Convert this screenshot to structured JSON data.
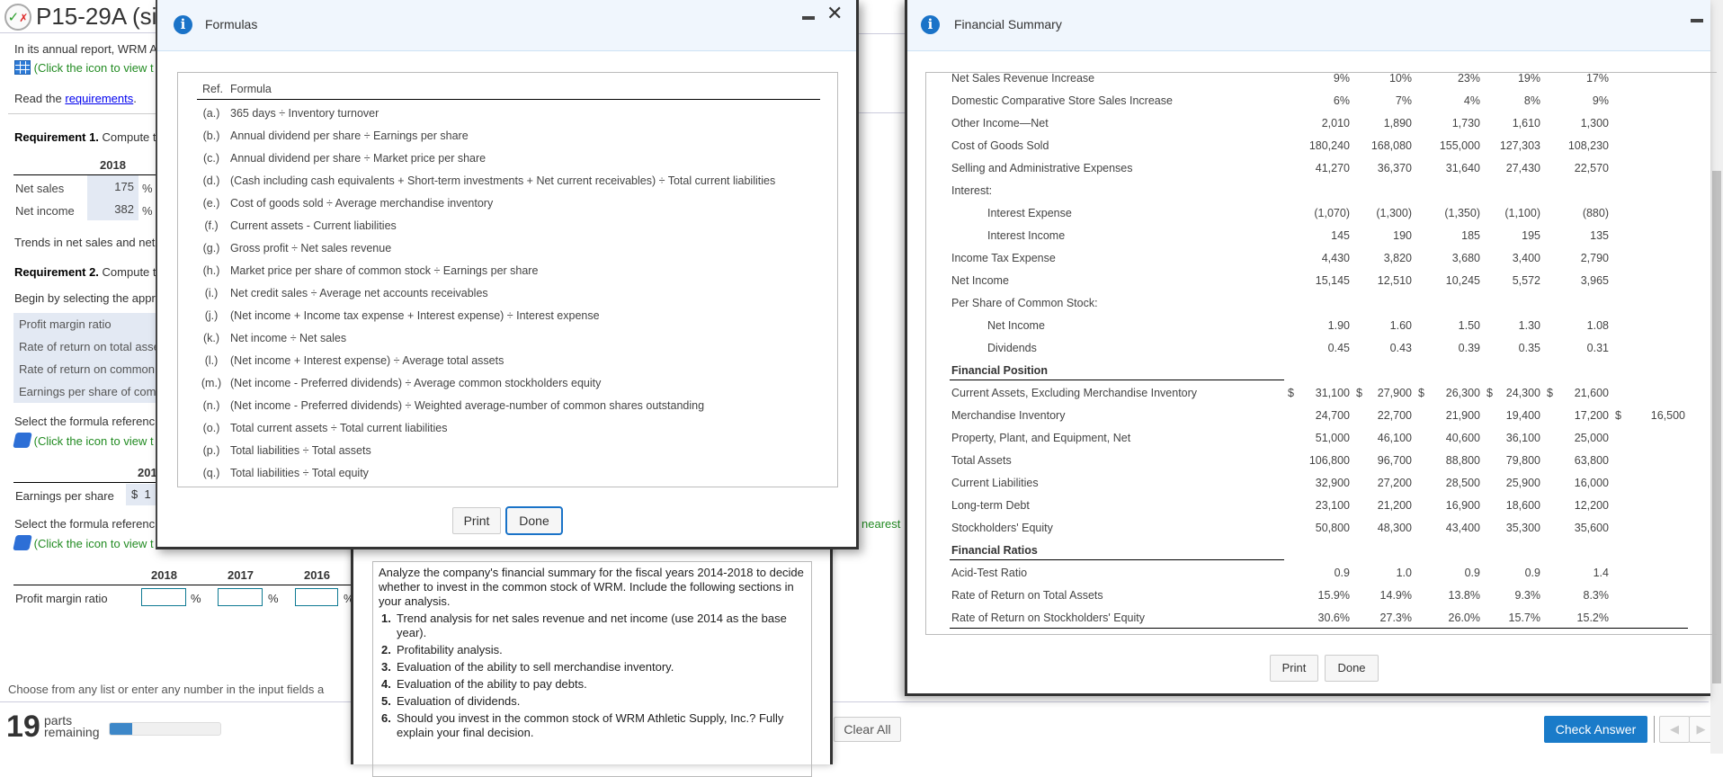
{
  "page": {
    "title": "P15-29A (sim",
    "intro": "In its annual report, WRM A",
    "click_icon_view": "(Click the icon to view t",
    "read_the": "Read the ",
    "requirements_link": "requirements",
    "read_period": ".",
    "req1_bold": "Requirement 1.",
    "req1_text": " Compute t",
    "req1_year": "2018",
    "req1_rows": [
      {
        "label": "Net sales",
        "value": "175",
        "unit": "%"
      },
      {
        "label": "Net income",
        "value": "382",
        "unit": "%"
      }
    ],
    "trends": "Trends in net sales and net",
    "req2_bold": "Requirement 2.",
    "req2_text": " Compute t",
    "begin": "Begin by selecting the appr",
    "ratio_list": [
      "Profit margin ratio",
      "Rate of return on total asse",
      "Rate of return on common",
      "Earnings per share of com"
    ],
    "select_formula_1": "Select the formula referenc",
    "click_icon_1": "(Click the icon to view t",
    "eps_year": "201",
    "eps_label": "Earnings per share",
    "eps_value": "$  1",
    "select_formula_2": "Select the formula referenc",
    "click_icon_2": "(Click the icon to view t",
    "pm_years": [
      "2018",
      "2017",
      "2016"
    ],
    "pm_label": "Profit margin ratio",
    "pm_unit": "%",
    "nearest": "nearest",
    "footer_hint": "Choose from any list or enter any number in the input fields a",
    "parts_count": "19",
    "parts_word1": "parts",
    "parts_word2": "remaining",
    "progress_fraction": 0.2,
    "clear_all": "Clear All",
    "check_answer": "Check Answer"
  },
  "formulas": {
    "title": "Formulas",
    "header_ref": "Ref.",
    "header_formula": "Formula",
    "rows": [
      {
        "ref": "(a.)",
        "formula": "365 days ÷ Inventory turnover"
      },
      {
        "ref": "(b.)",
        "formula": "Annual dividend per share ÷ Earnings per share"
      },
      {
        "ref": "(c.)",
        "formula": "Annual dividend per share ÷ Market price per share"
      },
      {
        "ref": "(d.)",
        "formula": "(Cash including cash equivalents + Short-term investments + Net current receivables) ÷ Total current liabilities"
      },
      {
        "ref": "(e.)",
        "formula": "Cost of goods sold ÷ Average merchandise inventory"
      },
      {
        "ref": "(f.)",
        "formula": "Current assets - Current liabilities"
      },
      {
        "ref": "(g.)",
        "formula": "Gross profit ÷ Net sales revenue"
      },
      {
        "ref": "(h.)",
        "formula": "Market price per share of common stock ÷ Earnings per share"
      },
      {
        "ref": "(i.)",
        "formula": "Net credit sales ÷ Average net accounts receivables"
      },
      {
        "ref": "(j.)",
        "formula": "(Net income + Income tax expense + Interest expense) ÷ Interest expense"
      },
      {
        "ref": "(k.)",
        "formula": "Net income ÷ Net sales"
      },
      {
        "ref": "(l.)",
        "formula": "(Net income + Interest expense) ÷ Average total assets"
      },
      {
        "ref": "(m.)",
        "formula": "(Net income - Preferred dividends) ÷ Average common stockholders equity"
      },
      {
        "ref": "(n.)",
        "formula": "(Net income - Preferred dividends) ÷ Weighted average-number of common shares outstanding"
      },
      {
        "ref": "(o.)",
        "formula": "Total current assets ÷ Total current liabilities"
      },
      {
        "ref": "(p.)",
        "formula": "Total liabilities ÷ Total assets"
      },
      {
        "ref": "(q.)",
        "formula": "Total liabilities ÷ Total equity"
      }
    ],
    "print": "Print",
    "done": "Done"
  },
  "requirements": {
    "intro": "Analyze the company's financial summary for the fiscal years 2014-2018 to decide whether to invest in the common stock of WRM. Include the following sections in your analysis.",
    "items": [
      {
        "num": "1.",
        "text": "Trend analysis for net sales revenue and net income (use 2014 as the base year)."
      },
      {
        "num": "2.",
        "text": "Profitability analysis."
      },
      {
        "num": "3.",
        "text": "Evaluation of the ability to sell merchandise inventory."
      },
      {
        "num": "4.",
        "text": "Evaluation of the ability to pay debts."
      },
      {
        "num": "5.",
        "text": "Evaluation of dividends."
      },
      {
        "num": "6.",
        "text": "Should you invest in the common stock of WRM Athletic Supply, Inc.? Fully explain your final decision."
      }
    ]
  },
  "financial_summary": {
    "title": "Financial Summary",
    "rows": [
      {
        "label": "Net Sales Revenue Increase",
        "values": [
          "9%",
          "10%",
          "23%",
          "19%",
          "17%"
        ]
      },
      {
        "label": "Domestic Comparative Store Sales Increase",
        "values": [
          "6%",
          "7%",
          "4%",
          "8%",
          "9%"
        ]
      },
      {
        "label": "Other Income—Net",
        "values": [
          "2,010",
          "1,890",
          "1,730",
          "1,610",
          "1,300"
        ]
      },
      {
        "label": "Cost of Goods Sold",
        "values": [
          "180,240",
          "168,080",
          "155,000",
          "127,303",
          "108,230"
        ]
      },
      {
        "label": "Selling and Administrative Expenses",
        "values": [
          "41,270",
          "36,370",
          "31,640",
          "27,430",
          "22,570"
        ]
      },
      {
        "label": "Interest:",
        "values": []
      },
      {
        "label": "Interest Expense",
        "indent": true,
        "values": [
          "(1,070)",
          "(1,300)",
          "(1,350)",
          "(1,100)",
          "(880)"
        ]
      },
      {
        "label": "Interest Income",
        "indent": true,
        "values": [
          "145",
          "190",
          "185",
          "195",
          "135"
        ]
      },
      {
        "label": "Income Tax Expense",
        "values": [
          "4,430",
          "3,820",
          "3,680",
          "3,400",
          "2,790"
        ]
      },
      {
        "label": "Net Income",
        "values": [
          "15,145",
          "12,510",
          "10,245",
          "5,572",
          "3,965"
        ]
      },
      {
        "label": "Per Share of Common Stock:",
        "values": []
      },
      {
        "label": "Net Income",
        "indent": true,
        "values": [
          "1.90",
          "1.60",
          "1.50",
          "1.30",
          "1.08"
        ]
      },
      {
        "label": "Dividends",
        "indent": true,
        "values": [
          "0.45",
          "0.43",
          "0.39",
          "0.35",
          "0.31"
        ]
      },
      {
        "label": "Financial Position",
        "heading": true,
        "values": []
      },
      {
        "label": "Current Assets, Excluding Merchandise Inventory",
        "dollars": [
          true,
          true,
          true,
          true,
          true
        ],
        "values": [
          "31,100",
          "27,900",
          "26,300",
          "24,300",
          "21,600"
        ]
      },
      {
        "label": "Merchandise Inventory",
        "dollars": [
          false,
          false,
          false,
          false,
          false,
          true
        ],
        "values": [
          "24,700",
          "22,700",
          "21,900",
          "19,400",
          "17,200",
          "16,500"
        ]
      },
      {
        "label": "Property, Plant, and Equipment, Net",
        "values": [
          "51,000",
          "46,100",
          "40,600",
          "36,100",
          "25,000"
        ]
      },
      {
        "label": "Total Assets",
        "values": [
          "106,800",
          "96,700",
          "88,800",
          "79,800",
          "63,800"
        ]
      },
      {
        "label": "Current Liabilities",
        "values": [
          "32,900",
          "27,200",
          "28,500",
          "25,900",
          "16,000"
        ]
      },
      {
        "label": "Long-term Debt",
        "values": [
          "23,100",
          "21,200",
          "16,900",
          "18,600",
          "12,200"
        ]
      },
      {
        "label": "Stockholders' Equity",
        "values": [
          "50,800",
          "48,300",
          "43,400",
          "35,300",
          "35,600"
        ]
      },
      {
        "label": "Financial Ratios",
        "heading": true,
        "values": []
      },
      {
        "label": "Acid-Test Ratio",
        "values": [
          "0.9",
          "1.0",
          "0.9",
          "0.9",
          "1.4"
        ]
      },
      {
        "label": "Rate of Return on Total Assets",
        "values": [
          "15.9%",
          "14.9%",
          "13.8%",
          "9.3%",
          "8.3%"
        ]
      },
      {
        "label": "Rate of Return on Stockholders' Equity",
        "values": [
          "30.6%",
          "27.3%",
          "26.0%",
          "15.7%",
          "15.2%"
        ]
      }
    ],
    "print": "Print",
    "done": "Done"
  },
  "colors": {
    "accent": "#1a73c8",
    "check_answer_bg": "#1a7bc9",
    "progress_fill": "#3d87c8",
    "link_green": "#228B22"
  }
}
